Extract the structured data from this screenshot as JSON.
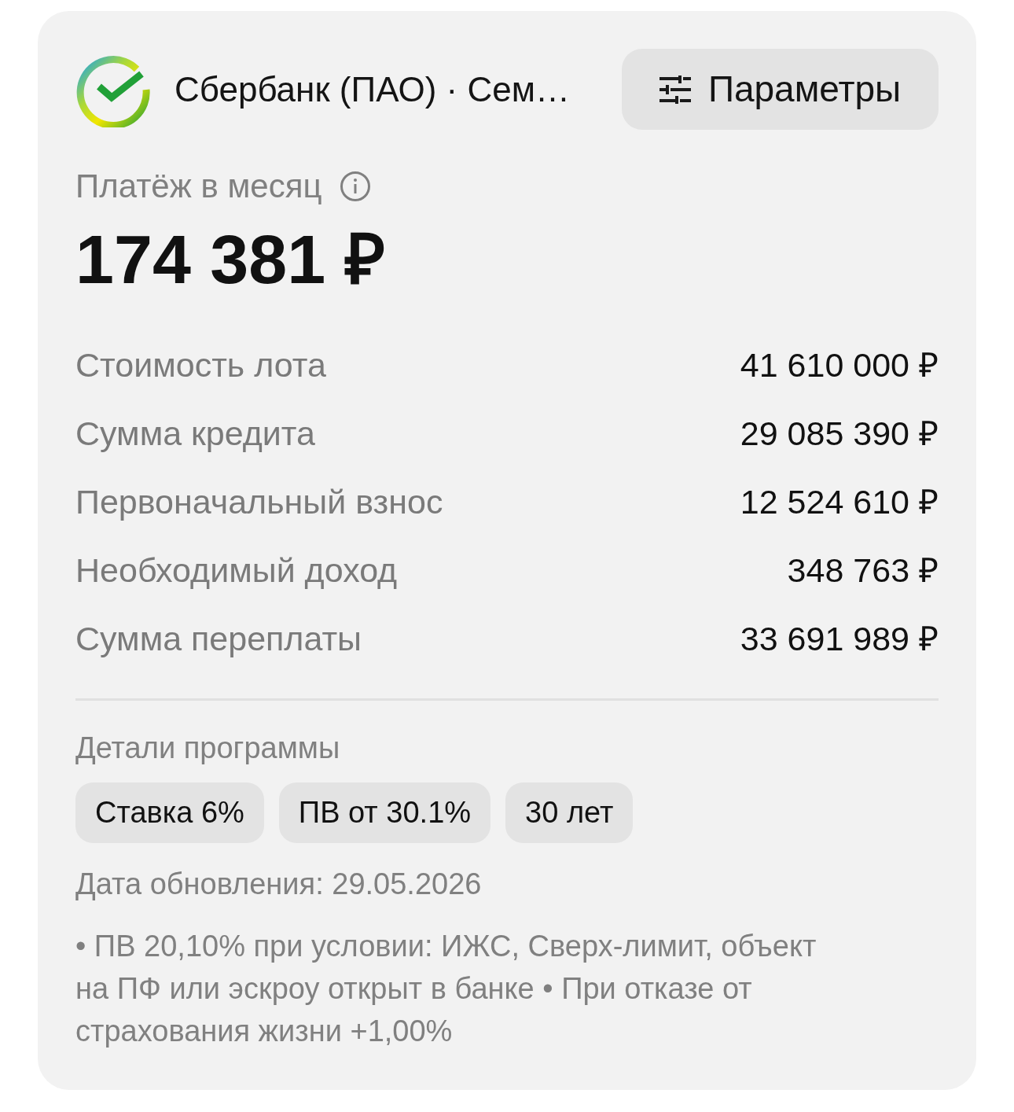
{
  "header": {
    "bank_name": "Сбербанк (ПАО) · Сем…",
    "params_button": "Параметры"
  },
  "payment": {
    "label": "Платёж в месяц",
    "amount": "174 381 ₽"
  },
  "details": [
    {
      "label": "Стоимость лота",
      "value": "41 610 000 ₽"
    },
    {
      "label": "Сумма кредита",
      "value": "29 085 390 ₽"
    },
    {
      "label": "Первоначальный взнос",
      "value": "12 524 610 ₽"
    },
    {
      "label": "Необходимый доход",
      "value": "348 763 ₽"
    },
    {
      "label": "Сумма переплаты",
      "value": "33 691 989 ₽"
    }
  ],
  "program": {
    "title": "Детали программы",
    "chips": [
      "Ставка 6%",
      "ПВ от 30.1%",
      "30 лет"
    ]
  },
  "updated": "Дата обновления: 29.05.2026",
  "note": "• ПВ 20,10% при условии: ИЖС, Сверх-лимит, объект на ПФ или эскроу открыт в банке • При отказе от страхования жизни +1,00%"
}
